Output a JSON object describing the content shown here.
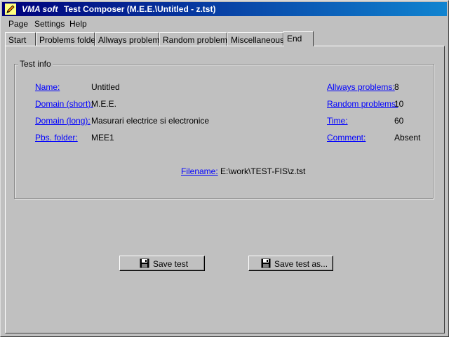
{
  "window": {
    "brand": "VMA soft",
    "title": "Test Composer (M.E.E.\\Untitled - z.tst)"
  },
  "menu": [
    {
      "label": "Page",
      "accel": "P"
    },
    {
      "label": "Settings",
      "accel": "S"
    },
    {
      "label": "Help",
      "accel": "H"
    }
  ],
  "tabs": [
    {
      "label": "Start"
    },
    {
      "label": "Problems folder"
    },
    {
      "label": "Allways problems"
    },
    {
      "label": "Random problems"
    },
    {
      "label": "Miscellaneous"
    },
    {
      "label": "End",
      "active": true
    }
  ],
  "test_info": {
    "title": "Test info",
    "name_label": "Name:",
    "name_value": "Untitled",
    "domain_short_label": "Domain (short):",
    "domain_short_value": "M.E.E.",
    "domain_long_label": "Domain (long):",
    "domain_long_value": "Masurari electrice si electronice",
    "pbs_folder_label": "Pbs. folder:",
    "pbs_folder_value": "MEE1",
    "allways_label": "Allways problems:",
    "allways_value": "8",
    "random_label": "Random problems:",
    "random_value": "10",
    "time_label": "Time:",
    "time_value": "60",
    "comment_label": "Comment:",
    "comment_value": "Absent",
    "filename_label": "Filename:",
    "filename_value": "E:\\work\\TEST-FIS\\z.tst"
  },
  "buttons": {
    "save": "Save test",
    "save_as": "Save test as..."
  },
  "colors": {
    "title_bar": "#00007b",
    "link": "#0000ff",
    "face": "#c0c0c0"
  },
  "icons": {
    "app": "pencil-icon",
    "save": "floppy-disk-icon"
  }
}
